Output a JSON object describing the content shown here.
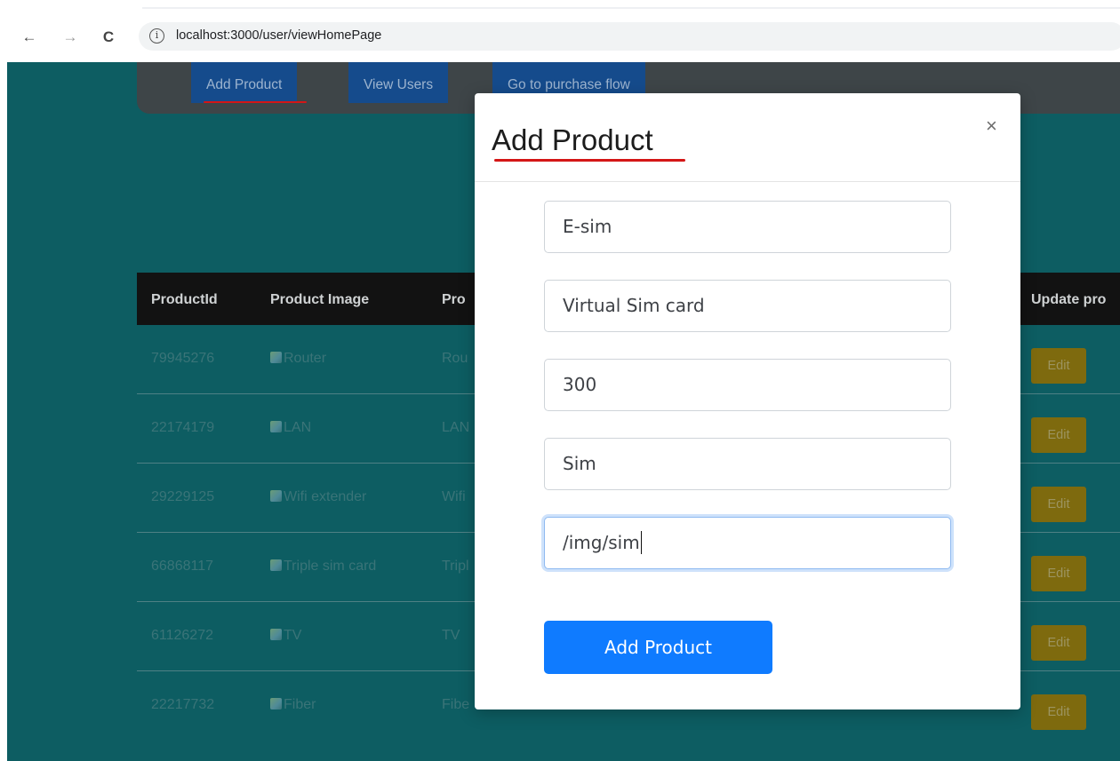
{
  "browser": {
    "back_icon": "←",
    "forward_icon": "→",
    "reload_icon": "C",
    "info_icon": "i",
    "url": "localhost:3000/user/viewHomePage"
  },
  "nav": {
    "add_product": "Add Product",
    "view_users": "View Users",
    "purchase_flow": "Go to purchase flow"
  },
  "table": {
    "headers": [
      "ProductId",
      "Product Image",
      "Pro",
      "Update pro"
    ],
    "rows": [
      {
        "id": "79945276",
        "image_alt": "Router",
        "name": "Rou",
        "edit": "Edit"
      },
      {
        "id": "22174179",
        "image_alt": "LAN",
        "name": "LAN",
        "edit": "Edit"
      },
      {
        "id": "29229125",
        "image_alt": "Wifi extender",
        "name": "Wifi",
        "edit": "Edit"
      },
      {
        "id": "66868117",
        "image_alt": "Triple sim card",
        "name": "Tripl",
        "edit": "Edit"
      },
      {
        "id": "61126272",
        "image_alt": "TV",
        "name": "TV",
        "edit": "Edit"
      },
      {
        "id": "22217732",
        "image_alt": "Fiber",
        "name": "Fibe",
        "edit": "Edit"
      }
    ]
  },
  "modal": {
    "title": "Add Product",
    "close": "×",
    "fields": [
      "E-sim",
      "Virtual Sim card",
      "300",
      "Sim",
      "/img/sim"
    ],
    "submit": "Add Product"
  },
  "colors": {
    "page_bg": "#0d5d62",
    "primary": "#0f7bff",
    "edit_button": "#7e6a0e",
    "underline": "#d41616"
  }
}
